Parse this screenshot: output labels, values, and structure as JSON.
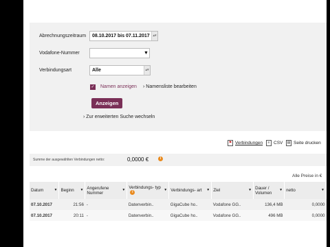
{
  "filters": {
    "period_label": "Abrechnungszeitraum",
    "period_value": "08.10.2017 bis 07.11.2017",
    "number_label": "Vodafone-Nummer",
    "number_value": "",
    "type_label": "Verbindungsart",
    "type_value": "Alle",
    "show_names_label": "Namen anzeigen",
    "show_names_checked": true,
    "edit_names_link": "Namensliste bearbeiten",
    "show_button": "Anzeigen",
    "advanced_search_link": "Zur erweiterten Suche wechseln"
  },
  "toolbar": {
    "connections_label": "Verbindungen",
    "csv_label": "CSV",
    "print_label": "Seite drucken"
  },
  "summary": {
    "label": "Summe der ausgewählten Verbindungen netto:",
    "value": "0,0000 €"
  },
  "prices_note": "Alle Preise in €",
  "table": {
    "headers": [
      "Datum",
      "Beginn",
      "Angerufene Nummer",
      "Verbindungs- typ",
      "Verbindungs- art",
      "Ziel",
      "Dauer / Volumen",
      "netto"
    ],
    "rows": [
      [
        "07.10.2017",
        "21:56",
        "-",
        "Datenverbin..",
        "GigaCube ho..",
        "Vodafone GG..",
        "136,4 MB",
        "0,0000"
      ],
      [
        "07.10.2017",
        "20:11",
        "-",
        "Datenverbin..",
        "GigaCube ho..",
        "Vodafone GG..",
        "496 MB",
        "0,0000"
      ]
    ]
  },
  "colors": {
    "accent": "#7a2f57",
    "info": "#e98a1e",
    "panel": "#f1f1f1"
  }
}
